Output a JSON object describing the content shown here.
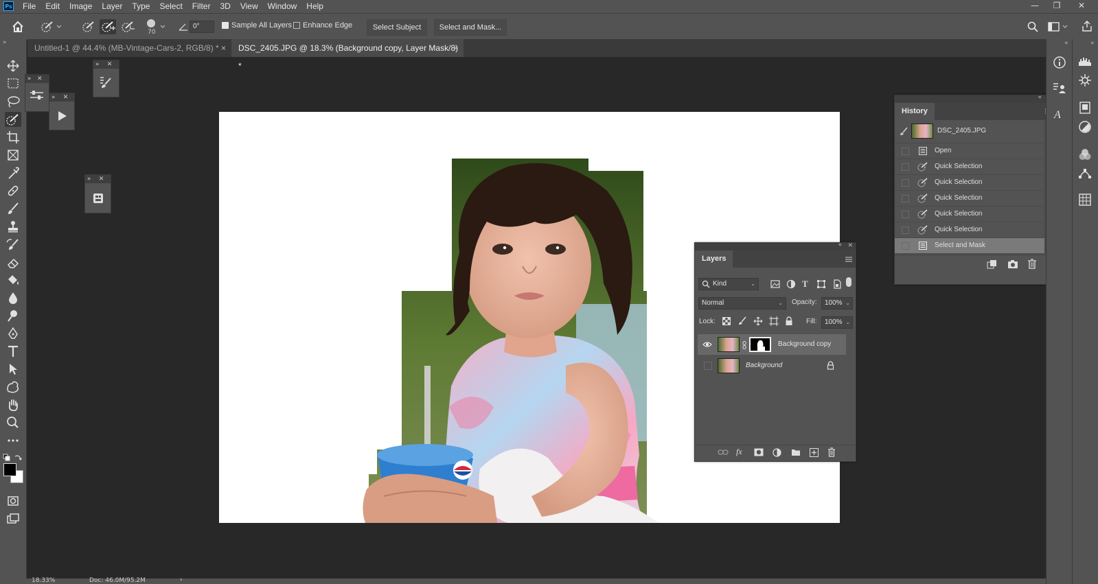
{
  "app": {
    "logo": "Ps"
  },
  "menu": [
    "File",
    "Edit",
    "Image",
    "Layer",
    "Type",
    "Select",
    "Filter",
    "3D",
    "View",
    "Window",
    "Help"
  ],
  "window_controls": {
    "minimize": "—",
    "restore": "❐",
    "close": "✕"
  },
  "options_bar": {
    "brush_size": "70",
    "angle": "0°",
    "sample_all_layers": "Sample All Layers",
    "enhance_edge": "Enhance Edge",
    "select_subject": "Select Subject",
    "select_and_mask": "Select and Mask..."
  },
  "tabs": [
    {
      "label": "Untitled-1 @ 44.4% (MB-Vintage-Cars-2, RGB/8) *",
      "close": "×"
    },
    {
      "label": "DSC_2405.JPG @ 18.3% (Background copy, Layer Mask/8) *",
      "close": "×"
    }
  ],
  "history": {
    "title": "History",
    "snapshot": "DSC_2405.JPG",
    "items": [
      "Open",
      "Quick Selection",
      "Quick Selection",
      "Quick Selection",
      "Quick Selection",
      "Quick Selection",
      "Select and Mask"
    ],
    "active_index": 6
  },
  "layers": {
    "title": "Layers",
    "filter_kind": "Kind",
    "blend_mode": "Normal",
    "opacity_label": "Opacity:",
    "opacity": "100%",
    "lock_label": "Lock:",
    "fill_label": "Fill:",
    "fill": "100%",
    "rows": [
      {
        "name": "Background copy"
      },
      {
        "name": "Background"
      }
    ]
  },
  "status": {
    "zoom": "18.33%",
    "doc": "Doc: 46.0M/95.2M",
    "arrow": "›"
  },
  "colors": {
    "accent": "#31a8ff",
    "ui": "#535353",
    "workspace": "#282828"
  }
}
